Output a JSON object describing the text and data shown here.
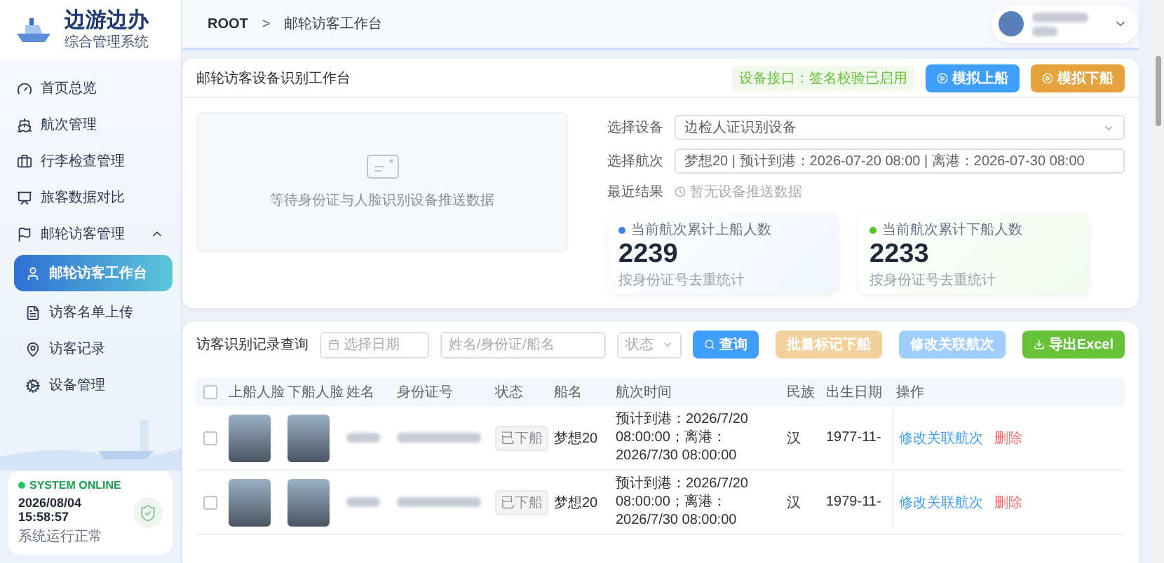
{
  "sidebar": {
    "logo": {
      "title": "边游边办",
      "subtitle": "综合管理系统"
    },
    "items": [
      {
        "label": "首页总览",
        "selected": false
      },
      {
        "label": "航次管理",
        "selected": false
      },
      {
        "label": "行李检查管理",
        "selected": false
      },
      {
        "label": "旅客数据对比",
        "selected": false
      },
      {
        "label": "邮轮访客管理",
        "selected": false,
        "expanded": true,
        "children": [
          {
            "label": "邮轮访客工作台",
            "selected": true
          },
          {
            "label": "访客名单上传",
            "selected": false
          },
          {
            "label": "访客记录",
            "selected": false
          },
          {
            "label": "设备管理",
            "selected": false
          }
        ]
      }
    ],
    "status": {
      "badge": "SYSTEM ONLINE",
      "time": "2026/08/04 15:58:57",
      "note": "系统运行正常"
    }
  },
  "header": {
    "breadcrumb": [
      "ROOT",
      "邮轮访客工作台"
    ],
    "separator": ">"
  },
  "workbench": {
    "title": "邮轮访客设备识别工作台",
    "badge": "设备接口：签名校验已启用",
    "buttons": [
      {
        "label": "模拟上船",
        "kind": "primary"
      },
      {
        "label": "模拟下船",
        "kind": "warning"
      }
    ],
    "empty_text": "等待身份证与人脸识别设备推送数据",
    "fields": [
      {
        "label": "选择设备",
        "value": "边检人证识别设备",
        "kind": "select"
      },
      {
        "label": "选择航次",
        "value": "梦想20 | 预计到港：2026-07-20 08:00 | 离港：2026-07-30 08:00",
        "kind": "input"
      },
      {
        "label": "最近结果",
        "value": "暂无设备推送数据",
        "kind": "result"
      }
    ],
    "stats": [
      {
        "label": "当前航次累计上船人数",
        "value": "2239",
        "note": "按身份证号去重统计",
        "color": "#3b82f6"
      },
      {
        "label": "当前航次累计下船人数",
        "value": "2233",
        "note": "按身份证号去重统计",
        "color": "#52c41a"
      }
    ]
  },
  "records": {
    "title": "访客识别记录查询",
    "filters": {
      "date_placeholder": "选择日期",
      "search_placeholder": "姓名/身份证/船名",
      "status_placeholder": "状态"
    },
    "buttons": [
      {
        "label": "查询",
        "kind": "primary",
        "disabled": false
      },
      {
        "label": "批量标记下船",
        "kind": "warning",
        "disabled": true
      },
      {
        "label": "修改关联航次",
        "kind": "primary",
        "disabled": true
      },
      {
        "label": "导出Excel",
        "kind": "success",
        "disabled": false
      }
    ],
    "select_all_checked": false,
    "columns": [
      "上船人脸",
      "下船人脸",
      "姓名",
      "身份证号",
      "状态",
      "船名",
      "航次时间",
      "民族",
      "出生日期",
      "操作"
    ],
    "rows": [
      {
        "checked": false,
        "status": "已下船",
        "ship": "梦想20",
        "voyage": "预计到港：2026/7/20 08:00:00；离港：2026/7/30 08:00:00",
        "ethnicity": "汉",
        "birth": "1977-11-",
        "actions": [
          "修改关联航次",
          "删除"
        ]
      },
      {
        "checked": false,
        "status": "已下船",
        "ship": "梦想20",
        "voyage": "预计到港：2026/7/20 08:00:00；离港：2026/7/30 08:00:00",
        "ethnicity": "汉",
        "birth": "1979-11-",
        "actions": [
          "修改关联航次",
          "删除"
        ]
      }
    ]
  }
}
